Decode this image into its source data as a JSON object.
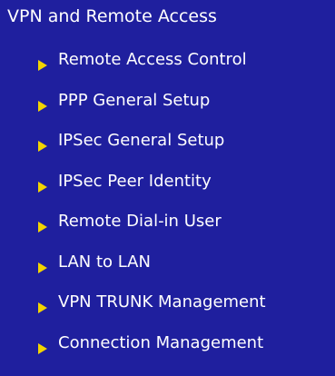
{
  "menu": {
    "title": "VPN and Remote Access",
    "items": [
      {
        "label": "Remote Access Control"
      },
      {
        "label": "PPP General Setup"
      },
      {
        "label": "IPSec General Setup"
      },
      {
        "label": "IPSec Peer Identity"
      },
      {
        "label": "Remote Dial-in User"
      },
      {
        "label": "LAN to LAN"
      },
      {
        "label": "VPN TRUNK Management"
      },
      {
        "label": "Connection Management"
      }
    ],
    "icon": "triangle-right-icon",
    "colors": {
      "background": "#1f1f9e",
      "text": "#ffffff",
      "arrow": "#f2d400"
    }
  }
}
